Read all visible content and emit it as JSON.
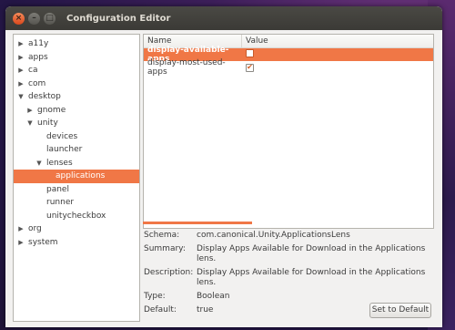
{
  "window": {
    "title": "Configuration Editor",
    "close_glyph": "×",
    "min_glyph": "–",
    "max_glyph": "□"
  },
  "tree": {
    "items": [
      {
        "label": "a11y",
        "level": 0,
        "arrow": "right"
      },
      {
        "label": "apps",
        "level": 0,
        "arrow": "right"
      },
      {
        "label": "ca",
        "level": 0,
        "arrow": "right"
      },
      {
        "label": "com",
        "level": 0,
        "arrow": "right"
      },
      {
        "label": "desktop",
        "level": 0,
        "arrow": "down"
      },
      {
        "label": "gnome",
        "level": 1,
        "arrow": "right"
      },
      {
        "label": "unity",
        "level": 1,
        "arrow": "down"
      },
      {
        "label": "devices",
        "level": 2,
        "arrow": ""
      },
      {
        "label": "launcher",
        "level": 2,
        "arrow": ""
      },
      {
        "label": "lenses",
        "level": 2,
        "arrow": "down"
      },
      {
        "label": "applications",
        "level": 3,
        "arrow": "",
        "selected": true
      },
      {
        "label": "panel",
        "level": 2,
        "arrow": ""
      },
      {
        "label": "runner",
        "level": 2,
        "arrow": ""
      },
      {
        "label": "unitycheckbox",
        "level": 2,
        "arrow": ""
      },
      {
        "label": "org",
        "level": 0,
        "arrow": "right"
      },
      {
        "label": "system",
        "level": 0,
        "arrow": "right"
      }
    ]
  },
  "table": {
    "headers": {
      "name": "Name",
      "value": "Value"
    },
    "rows": [
      {
        "name": "display-available-apps",
        "checked": false,
        "selected": true
      },
      {
        "name": "display-most-used-apps",
        "checked": true,
        "selected": false
      }
    ]
  },
  "details": {
    "schema_label": "Schema:",
    "schema_value": "com.canonical.Unity.ApplicationsLens",
    "summary_label": "Summary:",
    "summary_value": "Display Apps Available for Download in the Applications lens.",
    "description_label": "Description:",
    "description_value": "Display Apps Available for Download in the Applications lens.",
    "type_label": "Type:",
    "type_value": "Boolean",
    "default_label": "Default:",
    "default_value": "true",
    "set_default_label": "Set to Default"
  },
  "colors": {
    "accent": "#f07746",
    "titlebar": "#3b3a36",
    "window_bg": "#f2f1f0"
  }
}
